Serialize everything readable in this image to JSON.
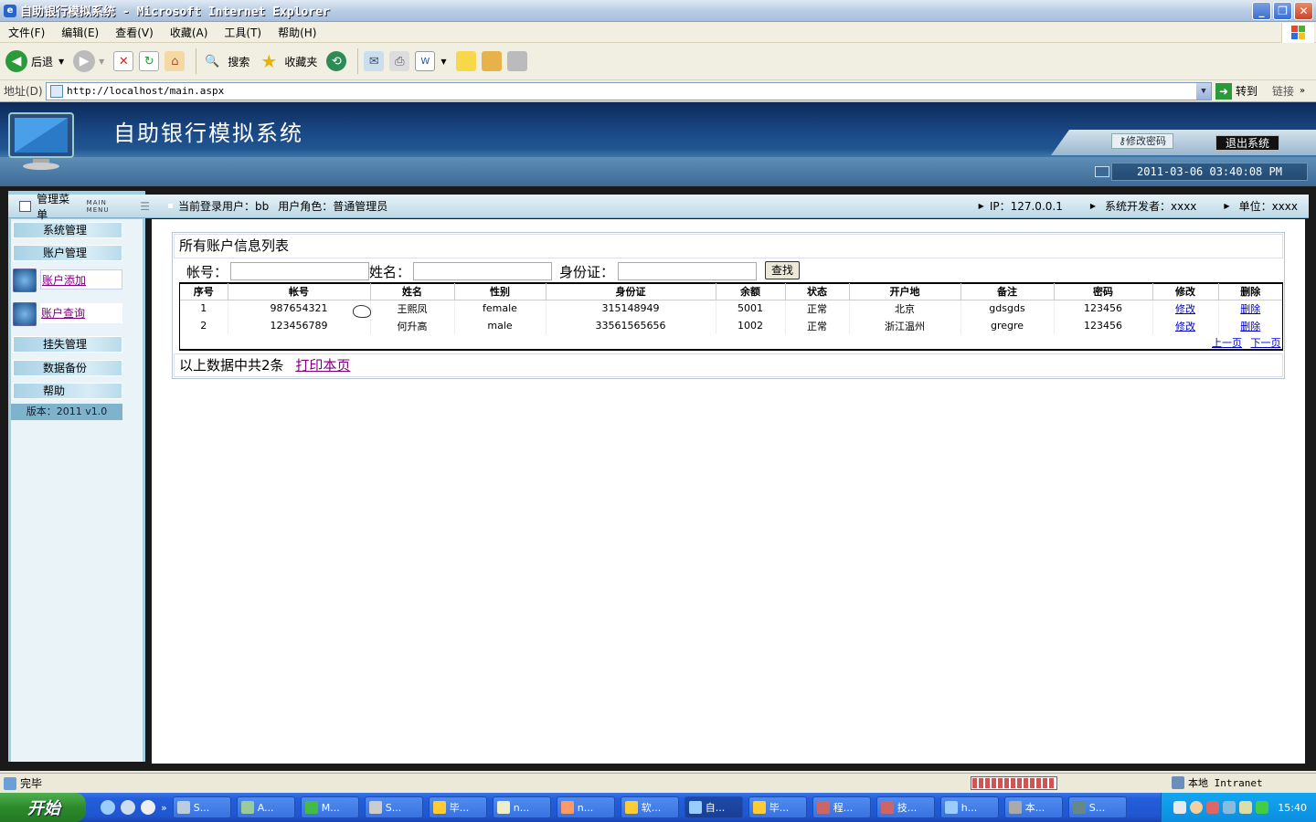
{
  "window": {
    "title": "自助银行模拟系统 - Microsoft Internet Explorer"
  },
  "menu": [
    "文件(F)",
    "编辑(E)",
    "查看(V)",
    "收藏(A)",
    "工具(T)",
    "帮助(H)"
  ],
  "toolbar": {
    "back": "后退",
    "search": "搜索",
    "favorites": "收藏夹"
  },
  "address": {
    "label": "地址(D)",
    "url": "http://localhost/main.aspx",
    "go": "转到",
    "links": "链接"
  },
  "header": {
    "title": "自助银行模拟系统",
    "change_password": "修改密码",
    "exit": "退出系统",
    "datetime": "2011-03-06 03:40:08 PM"
  },
  "sidebar": {
    "title": "管理菜单",
    "title_en": "MAIN MENU",
    "items": {
      "system": "系统管理",
      "account": "账户管理",
      "add": "账户添加",
      "query": "账户查询",
      "loss": "挂失管理",
      "backup": "数据备份",
      "help": "帮助"
    },
    "version": "版本：2011 v1.0"
  },
  "infobar": {
    "user": "当前登录用户：bb",
    "role": "用户角色：普通管理员",
    "ip": "IP：127.0.0.1",
    "developer": "系统开发者：xxxx",
    "unit": "单位：xxxx"
  },
  "main": {
    "list_title": "所有账户信息列表",
    "search": {
      "account_label": "帐号：",
      "name_label": "姓名：",
      "id_label": "身份证：",
      "find_button": "查找"
    },
    "table": {
      "headers": [
        "序号",
        "帐号",
        "姓名",
        "性别",
        "身份证",
        "余额",
        "状态",
        "开户地",
        "备注",
        "密码",
        "修改",
        "删除"
      ],
      "rows": [
        [
          "1",
          "987654321",
          "王熙凤",
          "female",
          "315148949",
          "5001",
          "正常",
          "北京",
          "gdsgds",
          "123456",
          "修改",
          "删除"
        ],
        [
          "2",
          "123456789",
          "何升高",
          "male",
          "33561565656",
          "1002",
          "正常",
          "浙江温州",
          "gregre",
          "123456",
          "修改",
          "删除"
        ]
      ]
    },
    "pager": {
      "prev": "上一页",
      "next": "下一页"
    },
    "summary": "以上数据中共2条",
    "print": "打印本页"
  },
  "status": {
    "text": "完毕",
    "zone": "本地 Intranet"
  },
  "taskbar": {
    "start": "开始",
    "tasks": [
      "S...",
      "A...",
      "M...",
      "S...",
      "毕...",
      "n...",
      "n...",
      "软...",
      "自...",
      "毕...",
      "程...",
      "技...",
      "h...",
      "本...",
      "S..."
    ],
    "clock": "15:40"
  },
  "colors": {
    "header_dark": "#0e2a5a",
    "panel_blue": "#9fcfe0",
    "link_purple": "#800080",
    "link_blue": "#0000cc"
  }
}
